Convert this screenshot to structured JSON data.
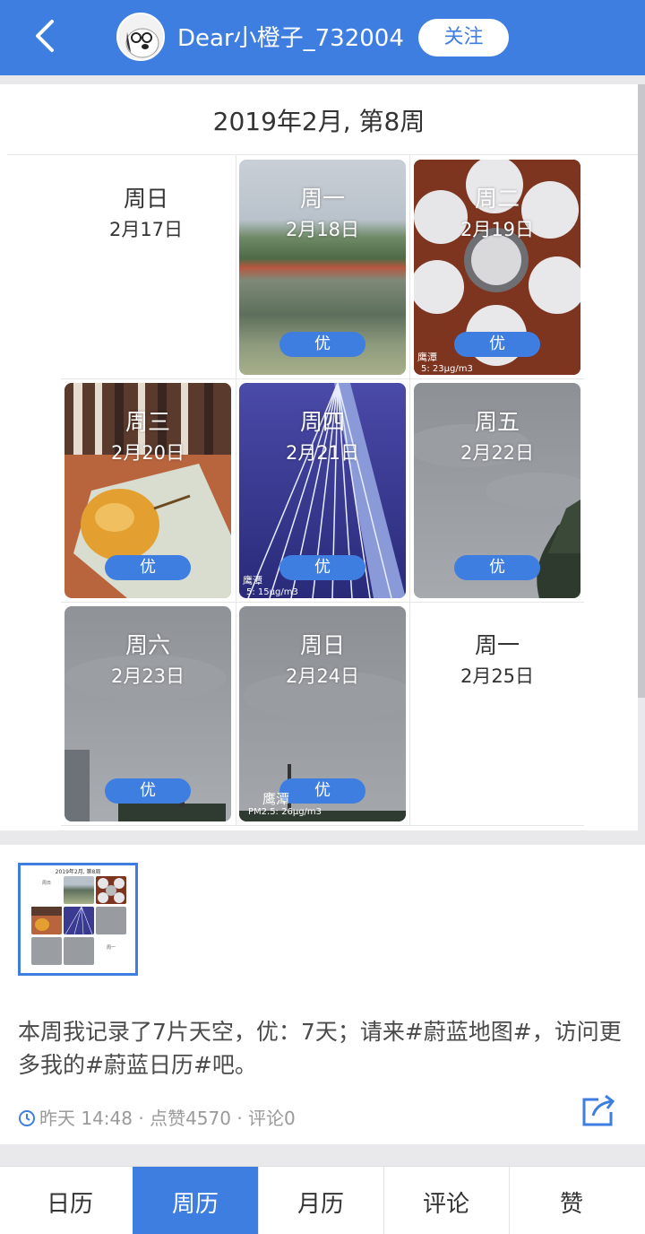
{
  "header": {
    "username": "Dear小橙子_732004",
    "follow_label": "关注"
  },
  "calendar": {
    "title": "2019年2月, 第8周",
    "days": [
      {
        "day": "周日",
        "date": "2月17日",
        "rating": ""
      },
      {
        "day": "周一",
        "date": "2月18日",
        "rating": "优"
      },
      {
        "day": "周二",
        "date": "2月19日",
        "rating": "优"
      },
      {
        "day": "周三",
        "date": "2月20日",
        "rating": "优"
      },
      {
        "day": "周四",
        "date": "2月21日",
        "rating": "优"
      },
      {
        "day": "周五",
        "date": "2月22日",
        "rating": "优"
      },
      {
        "day": "周六",
        "date": "2月23日",
        "rating": "优"
      },
      {
        "day": "周日",
        "date": "2月24日",
        "rating": "优"
      },
      {
        "day": "周一",
        "date": "2月25日",
        "rating": ""
      }
    ],
    "photo_text": {
      "d2_city": "鹰潭",
      "d2_pm": "5: 23μg/m3",
      "d4_city": "鹰潭",
      "d4_pm": "5: 15μg/m3",
      "d8_city": "鹰潭",
      "d8_pm": "PM2.5: 26μg/m3"
    }
  },
  "post": {
    "thumbnail_title": "2019年2月, 第8周",
    "text": "本周我记录了7片天空，优：7天；请来#蔚蓝地图#，访问更多我的#蔚蓝日历#吧。",
    "meta": "昨天 14:48 · 点赞4570 · 评论0"
  },
  "tabs": [
    {
      "label": "日历",
      "active": false
    },
    {
      "label": "周历",
      "active": true
    },
    {
      "label": "月历",
      "active": false
    },
    {
      "label": "评论",
      "active": false
    },
    {
      "label": "赞",
      "active": false
    }
  ],
  "colors": {
    "accent": "#3f7ee1"
  }
}
